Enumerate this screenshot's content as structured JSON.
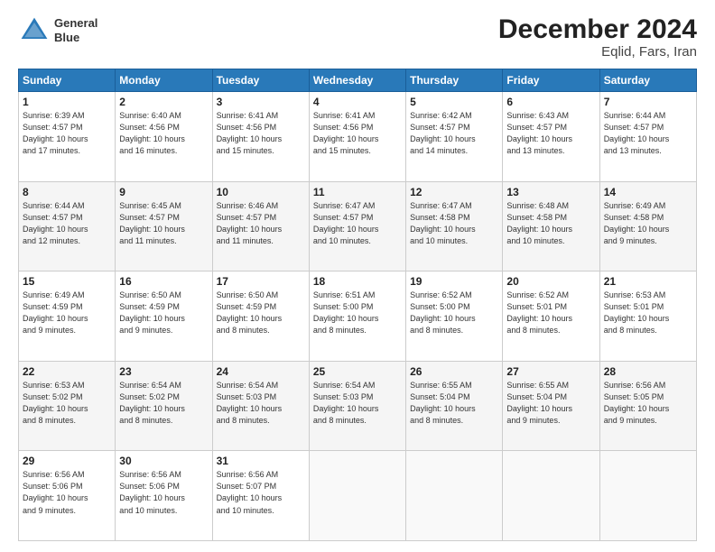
{
  "header": {
    "logo_line1": "General",
    "logo_line2": "Blue",
    "title": "December 2024",
    "subtitle": "Eqlid, Fars, Iran"
  },
  "weekdays": [
    "Sunday",
    "Monday",
    "Tuesday",
    "Wednesday",
    "Thursday",
    "Friday",
    "Saturday"
  ],
  "weeks": [
    [
      {
        "day": "1",
        "info": "Sunrise: 6:39 AM\nSunset: 4:57 PM\nDaylight: 10 hours\nand 17 minutes."
      },
      {
        "day": "2",
        "info": "Sunrise: 6:40 AM\nSunset: 4:56 PM\nDaylight: 10 hours\nand 16 minutes."
      },
      {
        "day": "3",
        "info": "Sunrise: 6:41 AM\nSunset: 4:56 PM\nDaylight: 10 hours\nand 15 minutes."
      },
      {
        "day": "4",
        "info": "Sunrise: 6:41 AM\nSunset: 4:56 PM\nDaylight: 10 hours\nand 15 minutes."
      },
      {
        "day": "5",
        "info": "Sunrise: 6:42 AM\nSunset: 4:57 PM\nDaylight: 10 hours\nand 14 minutes."
      },
      {
        "day": "6",
        "info": "Sunrise: 6:43 AM\nSunset: 4:57 PM\nDaylight: 10 hours\nand 13 minutes."
      },
      {
        "day": "7",
        "info": "Sunrise: 6:44 AM\nSunset: 4:57 PM\nDaylight: 10 hours\nand 13 minutes."
      }
    ],
    [
      {
        "day": "8",
        "info": "Sunrise: 6:44 AM\nSunset: 4:57 PM\nDaylight: 10 hours\nand 12 minutes."
      },
      {
        "day": "9",
        "info": "Sunrise: 6:45 AM\nSunset: 4:57 PM\nDaylight: 10 hours\nand 11 minutes."
      },
      {
        "day": "10",
        "info": "Sunrise: 6:46 AM\nSunset: 4:57 PM\nDaylight: 10 hours\nand 11 minutes."
      },
      {
        "day": "11",
        "info": "Sunrise: 6:47 AM\nSunset: 4:57 PM\nDaylight: 10 hours\nand 10 minutes."
      },
      {
        "day": "12",
        "info": "Sunrise: 6:47 AM\nSunset: 4:58 PM\nDaylight: 10 hours\nand 10 minutes."
      },
      {
        "day": "13",
        "info": "Sunrise: 6:48 AM\nSunset: 4:58 PM\nDaylight: 10 hours\nand 10 minutes."
      },
      {
        "day": "14",
        "info": "Sunrise: 6:49 AM\nSunset: 4:58 PM\nDaylight: 10 hours\nand 9 minutes."
      }
    ],
    [
      {
        "day": "15",
        "info": "Sunrise: 6:49 AM\nSunset: 4:59 PM\nDaylight: 10 hours\nand 9 minutes."
      },
      {
        "day": "16",
        "info": "Sunrise: 6:50 AM\nSunset: 4:59 PM\nDaylight: 10 hours\nand 9 minutes."
      },
      {
        "day": "17",
        "info": "Sunrise: 6:50 AM\nSunset: 4:59 PM\nDaylight: 10 hours\nand 8 minutes."
      },
      {
        "day": "18",
        "info": "Sunrise: 6:51 AM\nSunset: 5:00 PM\nDaylight: 10 hours\nand 8 minutes."
      },
      {
        "day": "19",
        "info": "Sunrise: 6:52 AM\nSunset: 5:00 PM\nDaylight: 10 hours\nand 8 minutes."
      },
      {
        "day": "20",
        "info": "Sunrise: 6:52 AM\nSunset: 5:01 PM\nDaylight: 10 hours\nand 8 minutes."
      },
      {
        "day": "21",
        "info": "Sunrise: 6:53 AM\nSunset: 5:01 PM\nDaylight: 10 hours\nand 8 minutes."
      }
    ],
    [
      {
        "day": "22",
        "info": "Sunrise: 6:53 AM\nSunset: 5:02 PM\nDaylight: 10 hours\nand 8 minutes."
      },
      {
        "day": "23",
        "info": "Sunrise: 6:54 AM\nSunset: 5:02 PM\nDaylight: 10 hours\nand 8 minutes."
      },
      {
        "day": "24",
        "info": "Sunrise: 6:54 AM\nSunset: 5:03 PM\nDaylight: 10 hours\nand 8 minutes."
      },
      {
        "day": "25",
        "info": "Sunrise: 6:54 AM\nSunset: 5:03 PM\nDaylight: 10 hours\nand 8 minutes."
      },
      {
        "day": "26",
        "info": "Sunrise: 6:55 AM\nSunset: 5:04 PM\nDaylight: 10 hours\nand 8 minutes."
      },
      {
        "day": "27",
        "info": "Sunrise: 6:55 AM\nSunset: 5:04 PM\nDaylight: 10 hours\nand 9 minutes."
      },
      {
        "day": "28",
        "info": "Sunrise: 6:56 AM\nSunset: 5:05 PM\nDaylight: 10 hours\nand 9 minutes."
      }
    ],
    [
      {
        "day": "29",
        "info": "Sunrise: 6:56 AM\nSunset: 5:06 PM\nDaylight: 10 hours\nand 9 minutes."
      },
      {
        "day": "30",
        "info": "Sunrise: 6:56 AM\nSunset: 5:06 PM\nDaylight: 10 hours\nand 10 minutes."
      },
      {
        "day": "31",
        "info": "Sunrise: 6:56 AM\nSunset: 5:07 PM\nDaylight: 10 hours\nand 10 minutes."
      },
      null,
      null,
      null,
      null
    ]
  ]
}
